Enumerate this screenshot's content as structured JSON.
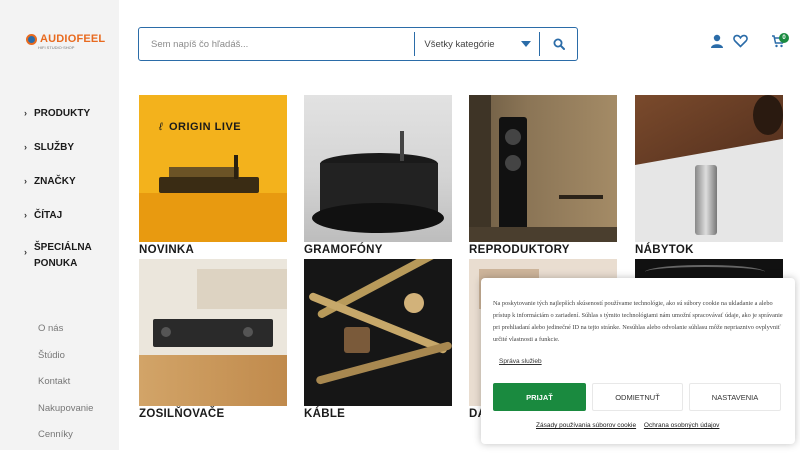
{
  "brand": {
    "name": "AUDIOFEEL",
    "tagline": "HIFI STUDIO·SHOP"
  },
  "nav": {
    "items": [
      {
        "label": "PRODUKTY"
      },
      {
        "label": "SLUŽBY"
      },
      {
        "label": "ZNAČKY"
      },
      {
        "label": "ČÍTAJ"
      },
      {
        "label": "ŠPECIÁLNA PONUKA"
      }
    ],
    "links": [
      "O nás",
      "Štúdio",
      "Kontakt",
      "Nakupovanie",
      "Cenníky"
    ]
  },
  "search": {
    "placeholder": "Sem napíš čo hľadáš...",
    "category": "Všetky kategórie"
  },
  "header": {
    "cart_count": "0"
  },
  "categories": [
    {
      "label": "NOVINKA",
      "overlay": "ORIGIN LIVE"
    },
    {
      "label": "GRAMOFÓNY"
    },
    {
      "label": "REPRODUKTORY"
    },
    {
      "label": "NÁBYTOK"
    },
    {
      "label": "ZOSILŇOVAČE"
    },
    {
      "label": "KÁBLE"
    },
    {
      "label": "DA"
    }
  ],
  "cookie": {
    "text": "Na poskytovanie tých najlepších skúseností používame technológie, ako sú súbory cookie na ukladanie a alebo prístup k informáciám o zariadení. Súhlas s týmito technológiami nám umožní spracovávať údaje, ako je správanie pri prehliadaní alebo jedinečné ID na tejto stránke. Nesúhlas alebo odvolanie súhlasu môže nepriaznivo ovplyvniť určité vlastnosti a funkcie.",
    "manage_label": "Správa služieb",
    "accept_label": "PRIJAŤ",
    "deny_label": "ODMIETNUŤ",
    "settings_label": "NASTAVENIA",
    "policy_link": "Zásady používania súborov cookie",
    "privacy_link": "Ochrana osobných údajov"
  },
  "colors": {
    "brand_orange": "#e86a1f",
    "brand_blue": "#2b6ca8",
    "accept_green": "#1a8a3f"
  }
}
